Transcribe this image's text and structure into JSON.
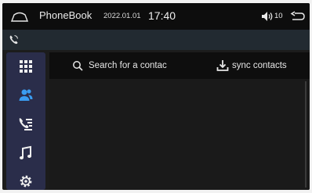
{
  "statusbar": {
    "home_icon": "home-outline-icon",
    "app_title": "PhoneBook",
    "date": "2022.01.01",
    "time": "17:40",
    "volume_icon": "speaker-icon",
    "volume_level": "10",
    "back_icon": "back-arrow-icon"
  },
  "callbar": {
    "icon": "phone-icon"
  },
  "sidebar": {
    "items": [
      {
        "name": "dialpad",
        "icon": "dialpad-icon",
        "active": false
      },
      {
        "name": "contacts",
        "icon": "contacts-icon",
        "active": true
      },
      {
        "name": "call-log",
        "icon": "call-log-icon",
        "active": false
      },
      {
        "name": "music",
        "icon": "music-icon",
        "active": false
      },
      {
        "name": "settings",
        "icon": "settings-icon",
        "active": false
      }
    ]
  },
  "toolbar": {
    "search_placeholder": "Search for a contac",
    "sync_label": "sync contacts"
  },
  "colors": {
    "accent": "#3a9cf0",
    "sidebar": "#2a2d4a",
    "background": "#1a1a1a"
  }
}
